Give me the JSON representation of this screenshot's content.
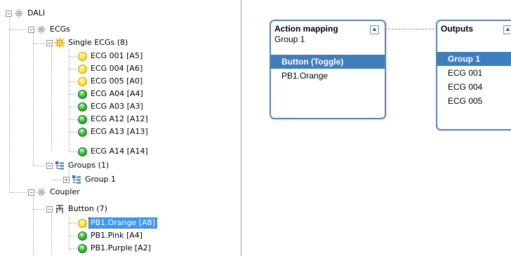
{
  "tree": {
    "root": "DALI",
    "ecgs": "ECGs",
    "single_ecgs": "Single ECGs (8)",
    "ecg_items": [
      {
        "label": "ECG 001 [A5]",
        "status": "yellow"
      },
      {
        "label": "ECG 004 [A6]",
        "status": "yellow"
      },
      {
        "label": "ECG 005 [A0]",
        "status": "yellow"
      },
      {
        "label": "ECG A04 [A4]",
        "status": "green"
      },
      {
        "label": "ECG A03 [A3]",
        "status": "green"
      },
      {
        "label": "ECG A12 [A12]",
        "status": "green"
      },
      {
        "label": "ECG A13 [A13]",
        "status": "green"
      },
      {
        "label": "ECG A14 [A14]",
        "status": "green"
      }
    ],
    "groups": "Groups (1)",
    "group_items": [
      "Group 1"
    ],
    "coupler": "Coupler",
    "button": "Button (7)",
    "button_items": [
      {
        "label": "PB1.Orange [A8]",
        "status": "yellow",
        "selected": true
      },
      {
        "label": "PB1.Pink [A4]",
        "status": "green"
      },
      {
        "label": "PB1.Purple [A2]",
        "status": "green"
      }
    ]
  },
  "diagram": {
    "action_mapping": {
      "title": "Action mapping",
      "subtitle": "Group 1",
      "selected_row": "Button (Toggle)",
      "rows": [
        "PB1.Orange"
      ]
    },
    "outputs": {
      "title": "Outputs",
      "selected_row": "Group 1",
      "rows": [
        "ECG 001",
        "ECG 004",
        "ECG 005"
      ]
    }
  },
  "colors": {
    "selection": "#3399ff",
    "card_border": "#5b86b0",
    "card_row_selected": "#3f7ebd",
    "status_yellow": "#ffe54a",
    "status_green": "#3ec23a"
  }
}
